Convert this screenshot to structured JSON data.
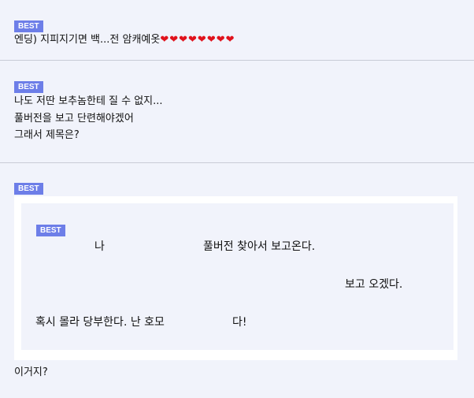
{
  "comments": [
    {
      "badge": "BEST",
      "text": "엔딩) 지피지기면 백...전 암캐예옷",
      "hearts": "❤❤❤❤❤❤❤❤"
    },
    {
      "badge": "BEST",
      "lines": [
        "나도 저딴 보추놈한테 질 수 없지...",
        "풀버전을 보고 단련해야겠어",
        "그래서 제목은?"
      ]
    },
    {
      "badge": "BEST",
      "quote": {
        "badge": "BEST",
        "line1_a": "나",
        "line1_b": "풀버전 찾아서 보고온다.",
        "line2": "보고 오겠다.",
        "line3_a": "혹시 몰라 당부한다. 난 호모",
        "line3_b": "다!"
      },
      "after": "이거지?"
    }
  ]
}
